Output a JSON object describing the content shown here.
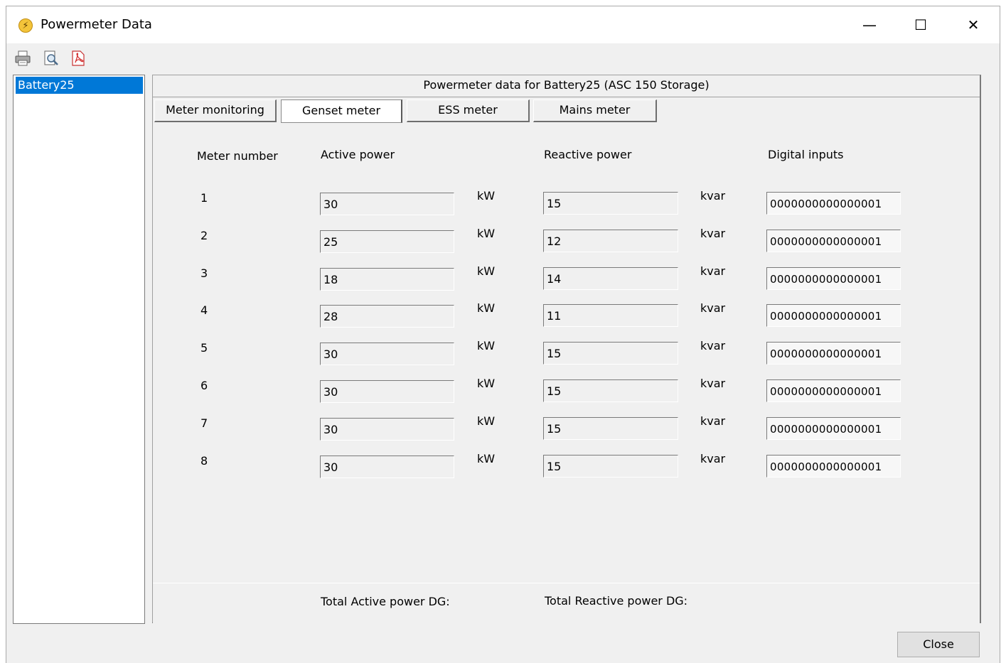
{
  "window": {
    "title": "Powermeter Data",
    "controls": {
      "minimize": "—",
      "maximize": "☐",
      "close": "✕"
    }
  },
  "toolbar": {
    "icons": [
      "print-icon",
      "print-preview-icon",
      "export-pdf-icon"
    ]
  },
  "device_list": {
    "items": [
      {
        "label": "Battery25",
        "selected": true
      }
    ]
  },
  "panel": {
    "header": "Powermeter data for Battery25 (ASC 150 Storage)",
    "tabs": [
      {
        "label": "Meter monitoring",
        "active": false
      },
      {
        "label": "Genset meter",
        "active": true
      },
      {
        "label": "ESS meter",
        "active": false
      },
      {
        "label": "Mains meter",
        "active": false
      }
    ],
    "columns": {
      "meter_number": "Meter number",
      "active_power": "Active power",
      "reactive_power": "Reactive power",
      "digital_inputs": "Digital inputs"
    },
    "active_unit": "kW",
    "reactive_unit": "kvar",
    "rows": [
      {
        "meter": "1",
        "active": "30",
        "reactive": "15",
        "digital": "0000000000000001"
      },
      {
        "meter": "2",
        "active": "25",
        "reactive": "12",
        "digital": "0000000000000001"
      },
      {
        "meter": "3",
        "active": "18",
        "reactive": "14",
        "digital": "0000000000000001"
      },
      {
        "meter": "4",
        "active": "28",
        "reactive": "11",
        "digital": "0000000000000001"
      },
      {
        "meter": "5",
        "active": "30",
        "reactive": "15",
        "digital": "0000000000000001"
      },
      {
        "meter": "6",
        "active": "30",
        "reactive": "15",
        "digital": "0000000000000001"
      },
      {
        "meter": "7",
        "active": "30",
        "reactive": "15",
        "digital": "0000000000000001"
      },
      {
        "meter": "8",
        "active": "30",
        "reactive": "15",
        "digital": "0000000000000001"
      }
    ],
    "totals": {
      "active_label": "Total Active power DG:",
      "reactive_label": "Total Reactive power DG:"
    }
  },
  "footer": {
    "close_label": "Close"
  },
  "colors": {
    "selection": "#0078d7",
    "window_bg": "#f0f0f0"
  }
}
